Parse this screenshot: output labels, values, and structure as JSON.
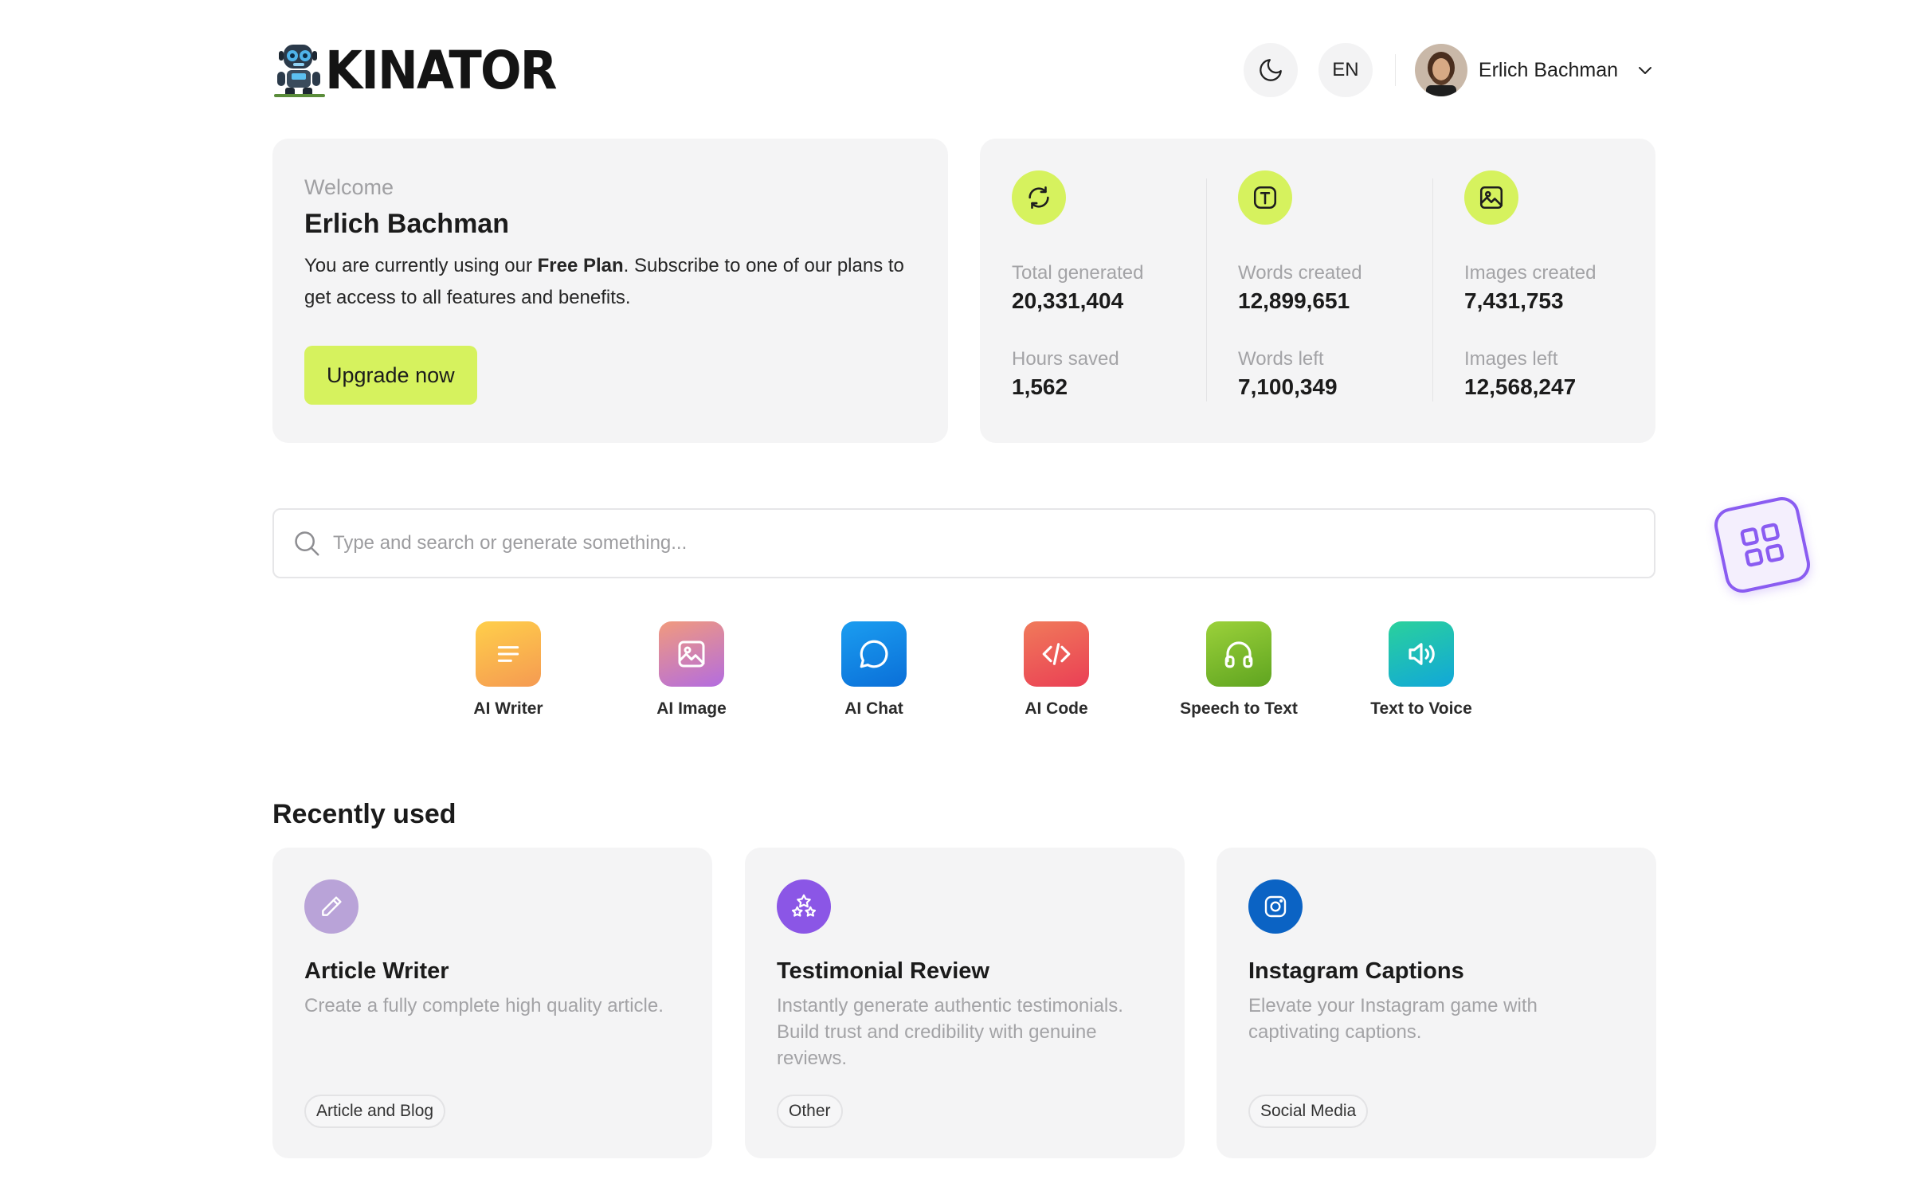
{
  "brand": {
    "logo_text": "KINATOR"
  },
  "header": {
    "language": "EN",
    "user_name": "Erlich Bachman",
    "theme_icon": "moon-icon",
    "dropdown_icon": "chevron-down-icon"
  },
  "welcome": {
    "label": "Welcome",
    "name": "Erlich Bachman",
    "text_before": "You are currently using our ",
    "plan": "Free Plan",
    "text_after": ". Subscribe to one of our plans to get access to all features and benefits.",
    "button": "Upgrade now"
  },
  "stats": [
    {
      "icon": "refresh-icon",
      "items": [
        {
          "label": "Total generated",
          "value": "20,331,404"
        },
        {
          "label": "Hours saved",
          "value": "1,562"
        }
      ]
    },
    {
      "icon": "text-icon",
      "items": [
        {
          "label": "Words created",
          "value": "12,899,651"
        },
        {
          "label": "Words left",
          "value": "7,100,349"
        }
      ]
    },
    {
      "icon": "image-icon",
      "items": [
        {
          "label": "Images created",
          "value": "7,431,753"
        },
        {
          "label": "Images left",
          "value": "12,568,247"
        }
      ]
    }
  ],
  "search": {
    "placeholder": "Type and search or generate something..."
  },
  "tools": [
    {
      "label": "AI Writer",
      "icon": "lines-icon"
    },
    {
      "label": "AI Image",
      "icon": "image-icon"
    },
    {
      "label": "AI Chat",
      "icon": "chat-bubble-icon"
    },
    {
      "label": "AI Code",
      "icon": "code-icon"
    },
    {
      "label": "Speech to Text",
      "icon": "headphones-icon"
    },
    {
      "label": "Text to Voice",
      "icon": "speaker-icon"
    }
  ],
  "recent": {
    "title": "Recently used",
    "items": [
      {
        "title": "Article Writer",
        "description": "Create a fully complete high quality article.",
        "tag": "Article and Blog",
        "icon": "pencil-icon",
        "color": "#b9a3d8"
      },
      {
        "title": "Testimonial Review",
        "description": "Instantly generate authentic testimonials. Build trust and credibility with genuine reviews.",
        "tag": "Other",
        "icon": "stars-icon",
        "color": "#8b56e6"
      },
      {
        "title": "Instagram Captions",
        "description": "Elevate your Instagram game with captivating captions.",
        "tag": "Social Media",
        "icon": "instagram-icon",
        "color": "#0b63c4"
      }
    ]
  },
  "colors": {
    "accent": "#d6f25e",
    "panel": "#f4f4f5",
    "floating": "#8a5cf1"
  }
}
